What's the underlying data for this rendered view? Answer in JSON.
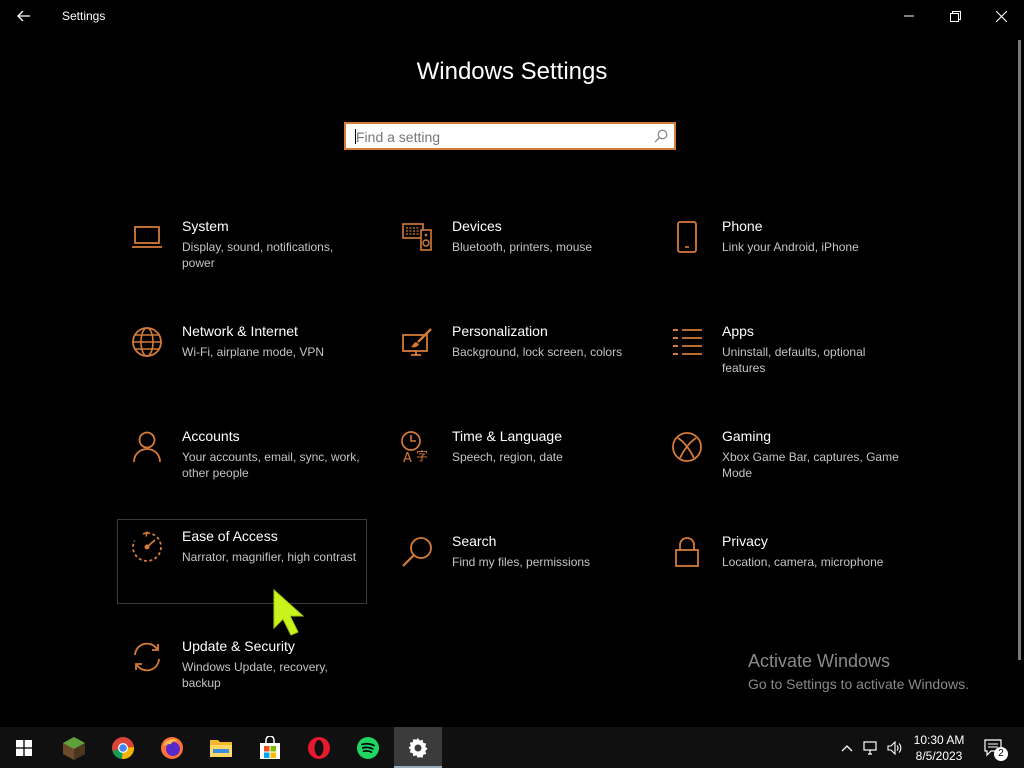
{
  "window": {
    "title": "Settings",
    "back_icon": "back-arrow-icon",
    "controls": [
      "minimize-icon",
      "restore-icon",
      "close-icon"
    ]
  },
  "page_title": "Windows Settings",
  "search": {
    "placeholder": "Find a setting",
    "value": "",
    "icon": "search-icon"
  },
  "accent_color": "#d47b39",
  "tiles": [
    {
      "id": "system",
      "icon": "laptop-icon",
      "title": "System",
      "desc": "Display, sound, notifications, power"
    },
    {
      "id": "devices",
      "icon": "devices-icon",
      "title": "Devices",
      "desc": "Bluetooth, printers, mouse"
    },
    {
      "id": "phone",
      "icon": "phone-icon",
      "title": "Phone",
      "desc": "Link your Android, iPhone"
    },
    {
      "id": "network",
      "icon": "globe-icon",
      "title": "Network & Internet",
      "desc": "Wi-Fi, airplane mode, VPN"
    },
    {
      "id": "personalization",
      "icon": "paintbrush-icon",
      "title": "Personalization",
      "desc": "Background, lock screen, colors"
    },
    {
      "id": "apps",
      "icon": "apps-list-icon",
      "title": "Apps",
      "desc": "Uninstall, defaults, optional features"
    },
    {
      "id": "accounts",
      "icon": "person-icon",
      "title": "Accounts",
      "desc": "Your accounts, email, sync, work, other people"
    },
    {
      "id": "time-language",
      "icon": "time-language-icon",
      "title": "Time & Language",
      "desc": "Speech, region, date"
    },
    {
      "id": "gaming",
      "icon": "xbox-icon",
      "title": "Gaming",
      "desc": "Xbox Game Bar, captures, Game Mode"
    },
    {
      "id": "ease-of-access",
      "icon": "ease-of-access-icon",
      "title": "Ease of Access",
      "desc": "Narrator, magnifier, high contrast"
    },
    {
      "id": "search",
      "icon": "magnifier-icon",
      "title": "Search",
      "desc": "Find my files, permissions"
    },
    {
      "id": "privacy",
      "icon": "lock-icon",
      "title": "Privacy",
      "desc": "Location, camera, microphone"
    },
    {
      "id": "update-security",
      "icon": "sync-icon",
      "title": "Update & Security",
      "desc": "Windows Update, recovery, backup"
    }
  ],
  "watermark": {
    "line1": "Activate Windows",
    "line2": "Go to Settings to activate Windows."
  },
  "taskbar": {
    "apps": [
      "windows-start-icon",
      "minecraft-icon",
      "chrome-icon",
      "firefox-icon",
      "file-explorer-icon",
      "microsoft-store-icon",
      "opera-icon",
      "spotify-icon",
      "settings-gear-icon"
    ],
    "active_app": "settings-gear-icon",
    "tray_icons": [
      "chevron-up-icon",
      "network-icon",
      "volume-icon"
    ],
    "time": "10:30 AM",
    "date": "8/5/2023",
    "notification_count": "2"
  }
}
